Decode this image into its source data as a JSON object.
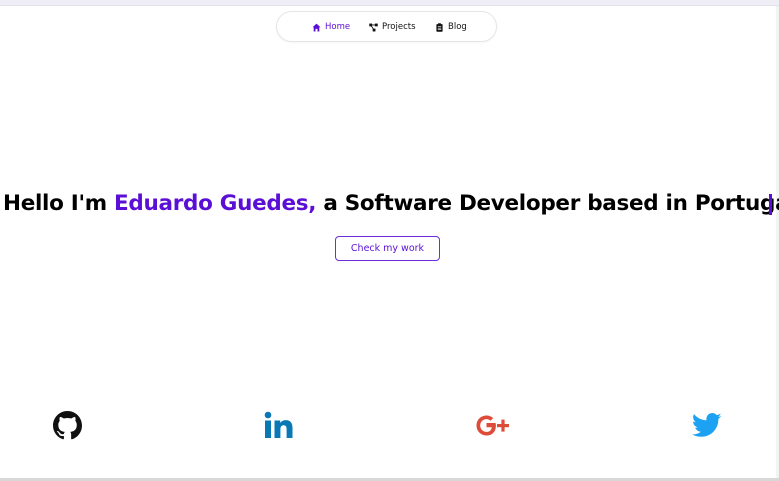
{
  "nav": {
    "items": [
      {
        "label": "Home",
        "icon": "home-icon",
        "active": true
      },
      {
        "label": "Projects",
        "icon": "project-tree-icon",
        "active": false
      },
      {
        "label": "Blog",
        "icon": "clipboard-icon",
        "active": false
      }
    ]
  },
  "hero": {
    "prefix": "Hello I'm",
    "name": "Eduardo Guedes,",
    "suffix": "a Software Developer based in Portugal!",
    "cta_label": "Check my work"
  },
  "social": [
    {
      "icon": "github-icon"
    },
    {
      "icon": "linkedin-icon"
    },
    {
      "icon": "google-plus-icon"
    },
    {
      "icon": "twitter-icon"
    }
  ],
  "colors": {
    "accent": "#5b0fd6",
    "text": "#000000",
    "linkedin": "#0a78b5",
    "google_plus": "#dd4b39",
    "twitter": "#1da1f2"
  }
}
